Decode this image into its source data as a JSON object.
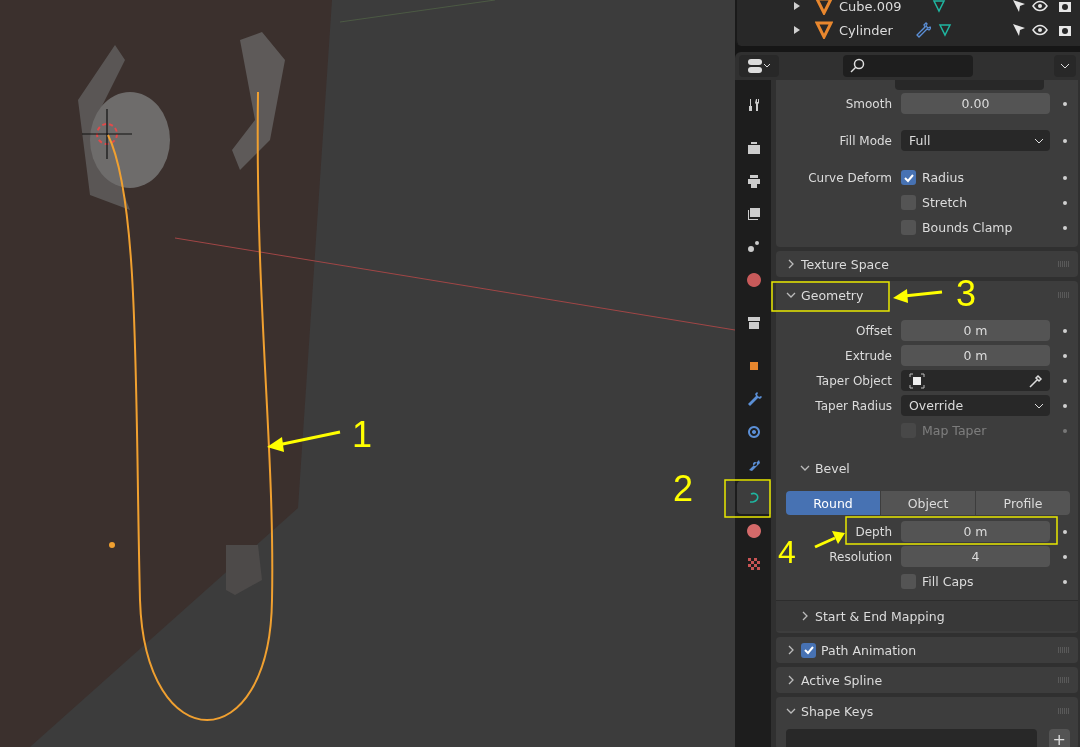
{
  "outliner": {
    "rows": [
      {
        "name": "Cube.009",
        "expanded": false,
        "modifiers": false
      },
      {
        "name": "Cylinder",
        "expanded": false,
        "modifiers": true
      }
    ]
  },
  "tab_groups": [
    [
      {
        "kind": "tool",
        "selected": false
      }
    ],
    [
      {
        "kind": "render",
        "selected": false
      },
      {
        "kind": "output",
        "selected": false
      },
      {
        "kind": "view_layer",
        "selected": false
      },
      {
        "kind": "scene",
        "selected": false
      },
      {
        "kind": "world",
        "selected": false
      }
    ],
    [
      {
        "kind": "collection",
        "selected": false
      }
    ],
    [
      {
        "kind": "object",
        "selected": false
      },
      {
        "kind": "modifiers",
        "selected": false
      },
      {
        "kind": "particles",
        "selected": false
      },
      {
        "kind": "physics",
        "selected": false
      },
      {
        "kind": "data",
        "selected": true
      },
      {
        "kind": "material",
        "selected": false
      },
      {
        "kind": "texture",
        "selected": false
      }
    ]
  ],
  "top_panel": {
    "groups": [
      [
        {
          "kind": "number",
          "label": "Smooth",
          "value": "0.00",
          "disabled": false
        }
      ],
      [
        {
          "kind": "dropdown",
          "label": "Fill Mode",
          "value": "Full",
          "disabled": false
        }
      ],
      [
        {
          "kind": "checkbox",
          "label": "Curve Deform",
          "text": "Radius",
          "checked": true,
          "disabled": false
        },
        {
          "kind": "checkbox",
          "text": "Stretch",
          "checked": false,
          "disabled": false
        },
        {
          "kind": "checkbox",
          "text": "Bounds Clamp",
          "checked": false,
          "disabled": false
        }
      ]
    ]
  },
  "panels": [
    {
      "title": "Texture Space",
      "expanded": false
    },
    {
      "title": "Geometry",
      "expanded": true,
      "rows": [
        {
          "kind": "number",
          "label": "Offset",
          "value": "0 m",
          "disabled": false
        },
        {
          "kind": "number",
          "label": "Extrude",
          "value": "0 m",
          "disabled": false
        },
        {
          "kind": "object",
          "label": "Taper Object",
          "disabled": false
        },
        {
          "kind": "dropdown",
          "label": "Taper Radius",
          "value": "Override",
          "disabled": false
        },
        {
          "kind": "checkbox",
          "text": "Map Taper",
          "checked": false,
          "disabled": true
        }
      ],
      "subpanels": [
        {
          "title": "Bevel",
          "expanded": true,
          "segments": [
            {
              "label": "Round",
              "selected": true
            },
            {
              "label": "Object",
              "selected": false
            },
            {
              "label": "Profile",
              "selected": false
            }
          ],
          "rows": [
            {
              "kind": "number",
              "label": "Depth",
              "value": "0 m",
              "disabled": false
            },
            {
              "kind": "number",
              "label": "Resolution",
              "value": "4",
              "disabled": false
            },
            {
              "kind": "checkbox",
              "text": "Fill Caps",
              "checked": false,
              "disabled": false
            }
          ]
        },
        {
          "title": "Start & End Mapping",
          "expanded": false
        }
      ]
    },
    {
      "title": "Path Animation",
      "expanded": false,
      "enabled": true
    },
    {
      "title": "Active Spline",
      "expanded": false
    },
    {
      "title": "Shape Keys",
      "expanded": true,
      "add": "+"
    }
  ],
  "annotations": [
    {
      "label": "1"
    },
    {
      "label": "2"
    },
    {
      "label": "3"
    },
    {
      "label": "4"
    }
  ]
}
